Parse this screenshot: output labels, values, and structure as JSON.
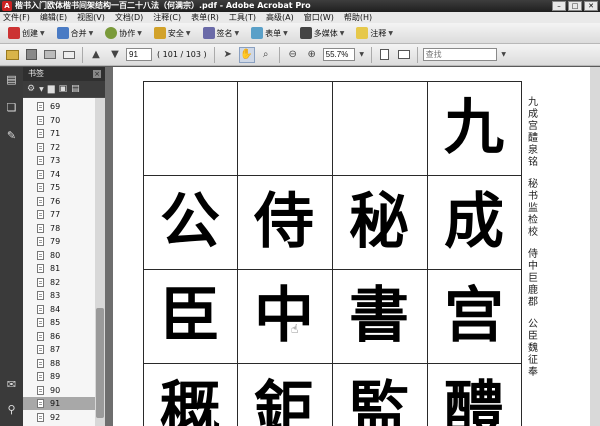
{
  "window": {
    "title": "楷书入门欧体楷书间架结构一百二十八法（何满宗）.pdf - Adobe Acrobat Pro"
  },
  "menu": [
    "文件(F)",
    "编辑(E)",
    "视图(V)",
    "文档(D)",
    "注释(C)",
    "表单(R)",
    "工具(T)",
    "高级(A)",
    "窗口(W)",
    "帮助(H)"
  ],
  "toolbar1": {
    "create": "创建",
    "combine": "合并",
    "collaborate": "协作",
    "secure": "安全",
    "sign": "签名",
    "forms": "表单",
    "multimedia": "多媒体",
    "comment": "注释"
  },
  "toolbar2": {
    "page_value": "91",
    "page_count": "( 101 / 103 )",
    "zoom_value": "55.7%",
    "search_placeholder": "查找"
  },
  "bookmarks": {
    "title": "书签",
    "items": [
      "69",
      "70",
      "71",
      "72",
      "73",
      "74",
      "75",
      "76",
      "77",
      "78",
      "79",
      "80",
      "81",
      "82",
      "83",
      "84",
      "85",
      "86",
      "87",
      "88",
      "89",
      "90",
      "91",
      "92"
    ],
    "selected": "91"
  },
  "document": {
    "glyphs": {
      "r0c3": "九",
      "r1c0": "公",
      "r1c1": "侍",
      "r1c2": "秘",
      "r1c3": "成",
      "r2c0": "臣",
      "r2c1": "中",
      "r2c2": "書",
      "r2c3": "宫",
      "r3c0": "穊",
      "r3c1": "鉅",
      "r3c2": "監",
      "r3c3": "醴"
    },
    "vertical_lines": [
      "九成宫醴泉铭",
      "秘书监检校",
      "侍中巨鹿郡",
      "公臣魏征奉"
    ]
  }
}
